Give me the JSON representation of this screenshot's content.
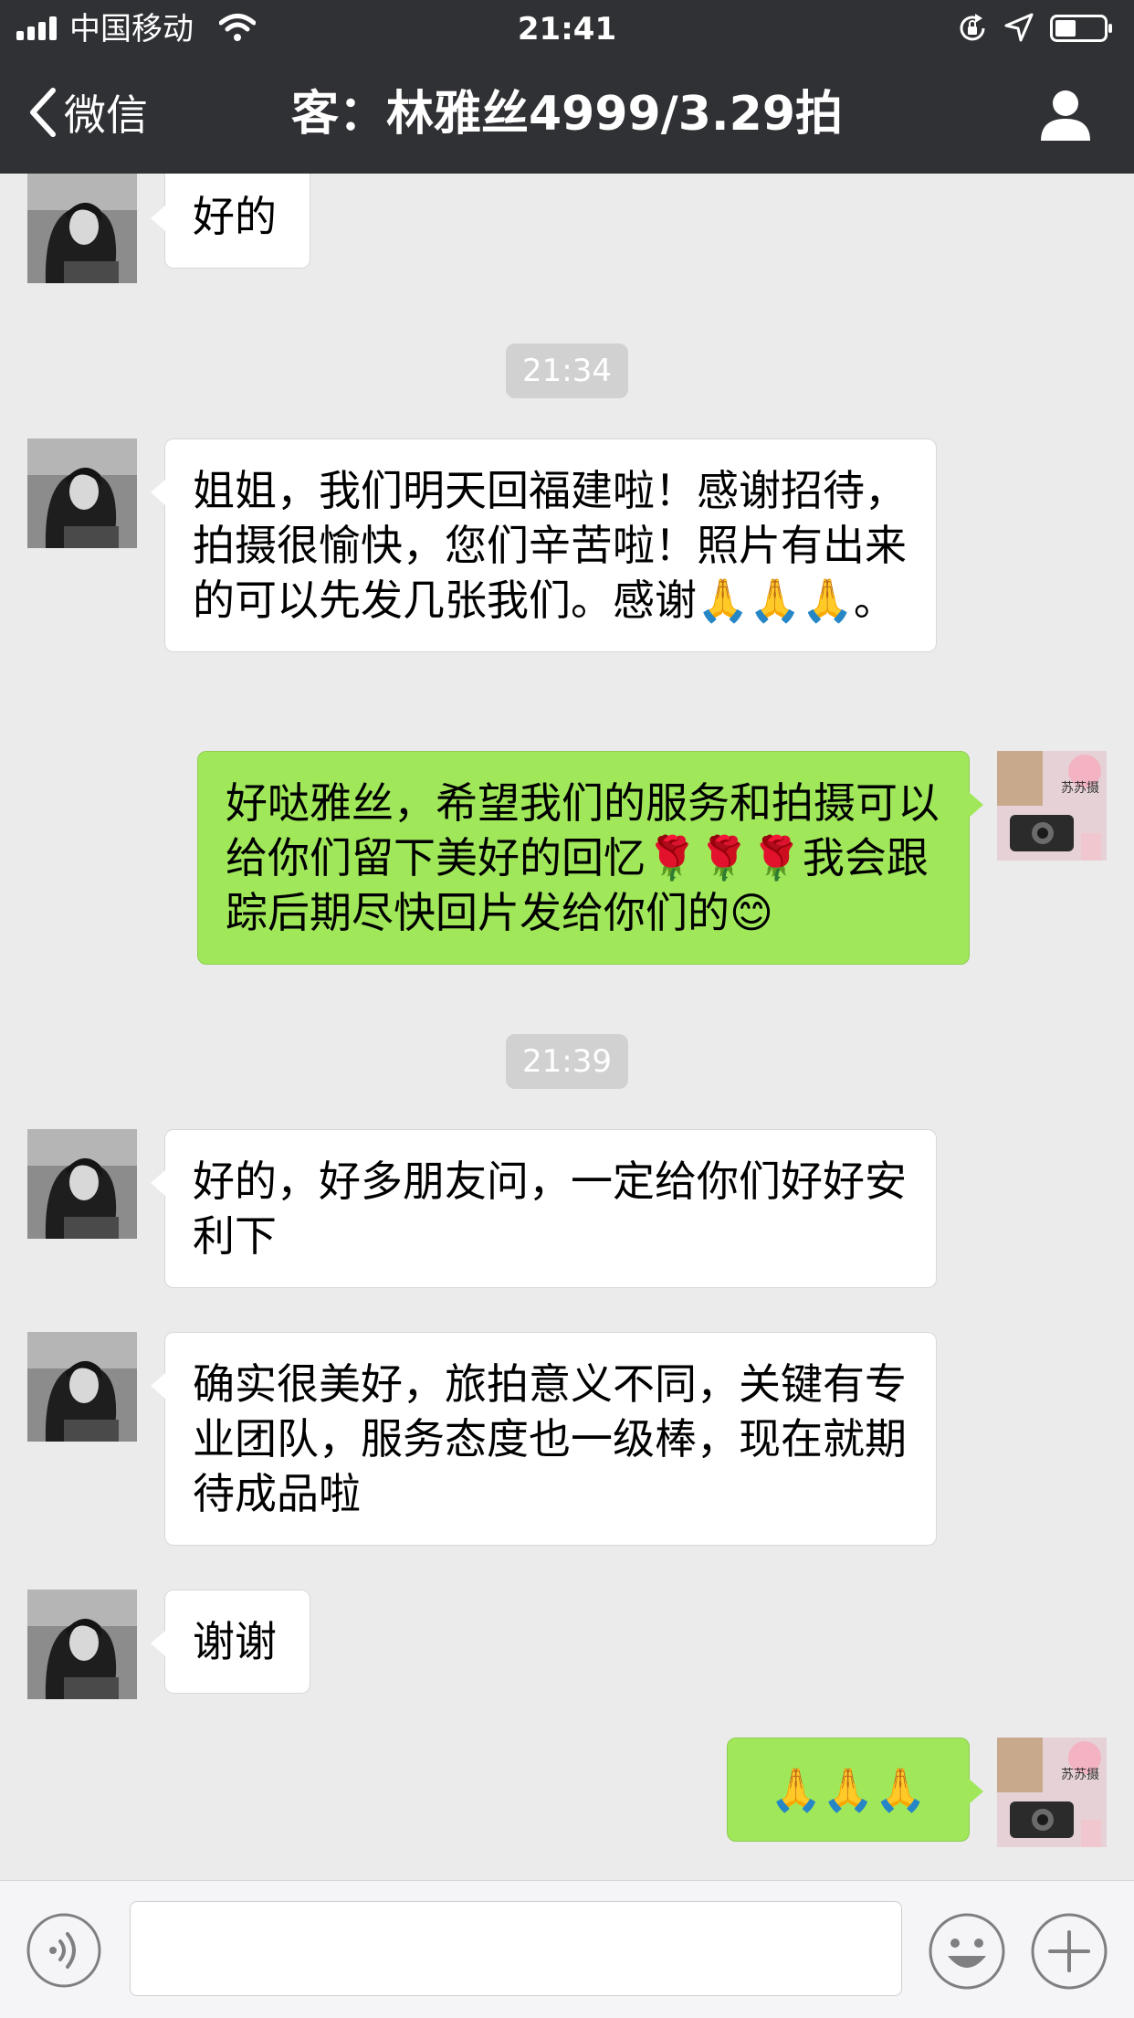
{
  "status_bar": {
    "carrier": "中国移动",
    "time": "21:41"
  },
  "nav": {
    "back_label": "微信",
    "title": "客：林雅丝4999/3.29拍"
  },
  "messages": [
    {
      "from": "contact",
      "text": "好的"
    },
    {
      "timestamp": "21:34"
    },
    {
      "from": "contact",
      "text": "姐姐，我们明天回福建啦！感谢招待，拍摄很愉快，您们辛苦啦！照片有出来的可以先发几张我们。感谢🙏🙏🙏。"
    },
    {
      "from": "me",
      "text": "好哒雅丝，希望我们的服务和拍摄可以给你们留下美好的回忆🌹🌹🌹我会跟踪后期尽快回片发给你们的😊"
    },
    {
      "timestamp": "21:39"
    },
    {
      "from": "contact",
      "text": "好的，好多朋友问，一定给你们好好安利下"
    },
    {
      "from": "contact",
      "text": "确实很美好，旅拍意义不同，关键有专业团队，服务态度也一级棒，现在就期待成品啦"
    },
    {
      "from": "contact",
      "text": "谢谢"
    },
    {
      "from": "me",
      "text": "🙏🙏🙏"
    }
  ],
  "my_avatar_text": "苏苏摄",
  "input": {
    "value": ""
  },
  "icons": {
    "back": "chevron-left-icon",
    "profile": "person-icon",
    "voice": "voice-icon",
    "emoji": "emoji-icon",
    "more": "plus-icon"
  },
  "colors": {
    "header_bg": "#303134",
    "chat_bg": "#ebebeb",
    "incoming_bubble": "#ffffff",
    "outgoing_bubble": "#a0e75a",
    "timestamp_bg": "#d1d1d1"
  }
}
